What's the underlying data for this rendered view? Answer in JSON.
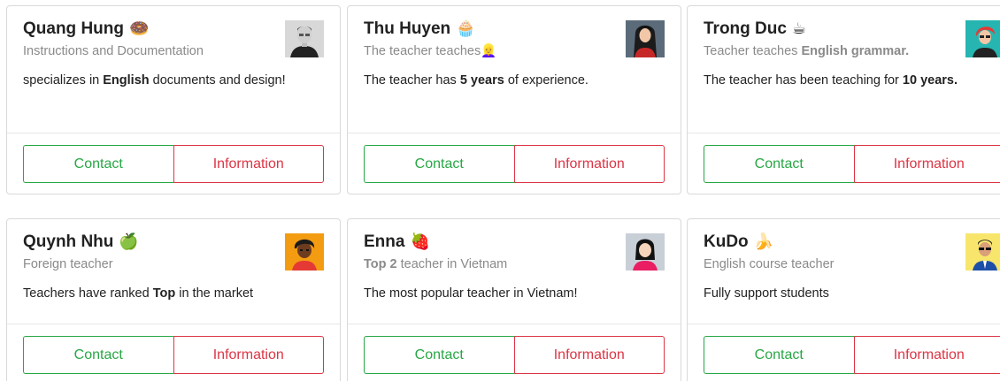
{
  "cards": [
    {
      "name": "Quang Hung",
      "emoji": "🍩",
      "subtitle_pre": "Instructions and Documentation",
      "subtitle_bold": "",
      "subtitle_post": "",
      "subtitle_emoji": "",
      "desc_pre": "specializes in ",
      "desc_bold": "English",
      "desc_post": " documents and design!",
      "avatar": "man-gray-avatar",
      "contact_label": "Contact",
      "info_label": "Information"
    },
    {
      "name": "Thu Huyen",
      "emoji": "🧁",
      "subtitle_pre": "The teacher teaches",
      "subtitle_bold": "",
      "subtitle_post": "",
      "subtitle_emoji": "👱‍♀️",
      "desc_pre": "The teacher has ",
      "desc_bold": "5 years",
      "desc_post": " of experience.",
      "avatar": "woman-long-hair-avatar",
      "contact_label": "Contact",
      "info_label": "Information"
    },
    {
      "name": "Trong Duc",
      "emoji": "☕",
      "subtitle_pre": "Teacher teaches ",
      "subtitle_bold": "English grammar.",
      "subtitle_post": "",
      "subtitle_emoji": "",
      "desc_pre": "The teacher has been teaching for ",
      "desc_bold": "10 years.",
      "desc_post": "",
      "avatar": "woman-red-hair-avatar",
      "contact_label": "Contact",
      "info_label": "Information"
    },
    {
      "name": "Quynh Nhu",
      "emoji": "🍏",
      "subtitle_pre": "Foreign teacher",
      "subtitle_bold": "",
      "subtitle_post": "",
      "subtitle_emoji": "",
      "desc_pre": "Teachers have ranked ",
      "desc_bold": "Top",
      "desc_post": " in the market",
      "avatar": "man-curly-hair-avatar",
      "contact_label": "Contact",
      "info_label": "Information"
    },
    {
      "name": "Enna",
      "emoji": "🍓",
      "subtitle_pre": "",
      "subtitle_bold": "Top 2",
      "subtitle_post": " teacher in Vietnam",
      "subtitle_emoji": "",
      "desc_pre": "The most popular teacher in Vietnam!",
      "desc_bold": "",
      "desc_post": "",
      "avatar": "woman-bob-hair-avatar",
      "contact_label": "Contact",
      "info_label": "Information"
    },
    {
      "name": "KuDo",
      "emoji": "🍌",
      "subtitle_pre": "English course teacher",
      "subtitle_bold": "",
      "subtitle_post": "",
      "subtitle_emoji": "",
      "desc_pre": "Fully support students",
      "desc_bold": "",
      "desc_post": "",
      "avatar": "man-suit-sunglasses-avatar",
      "contact_label": "Contact",
      "info_label": "Information"
    }
  ],
  "colors": {
    "contact": "#28a745",
    "information": "#dc3545",
    "subtitle": "#8a8a8a"
  }
}
